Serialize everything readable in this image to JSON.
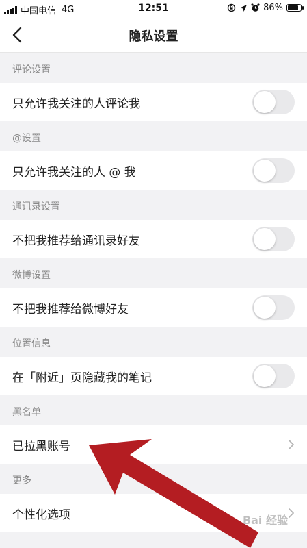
{
  "status_bar": {
    "carrier": "中国电信",
    "network": "4G",
    "time": "12:51",
    "battery": "86%",
    "battery_level": 0.86
  },
  "nav": {
    "title": "隐私设置"
  },
  "sections": [
    {
      "header": "评论设置",
      "row": "只允许我关注的人评论我",
      "type": "toggle",
      "on": false
    },
    {
      "header": "@设置",
      "row": "只允许我关注的人 @ 我",
      "type": "toggle",
      "on": false
    },
    {
      "header": "通讯录设置",
      "row": "不把我推荐给通讯录好友",
      "type": "toggle",
      "on": false
    },
    {
      "header": "微博设置",
      "row": "不把我推荐给微博好友",
      "type": "toggle",
      "on": false
    },
    {
      "header": "位置信息",
      "row": "在「附近」页隐藏我的笔记",
      "type": "toggle",
      "on": false
    },
    {
      "header": "黑名单",
      "row": "已拉黑账号",
      "type": "link"
    },
    {
      "header": "更多",
      "row": "个性化选项",
      "type": "link"
    }
  ],
  "colors": {
    "background": "#f2f2f4",
    "toggle_off": "#e9e9eb",
    "annotation_arrow": "#b01116"
  },
  "watermark": "Bai 经验"
}
